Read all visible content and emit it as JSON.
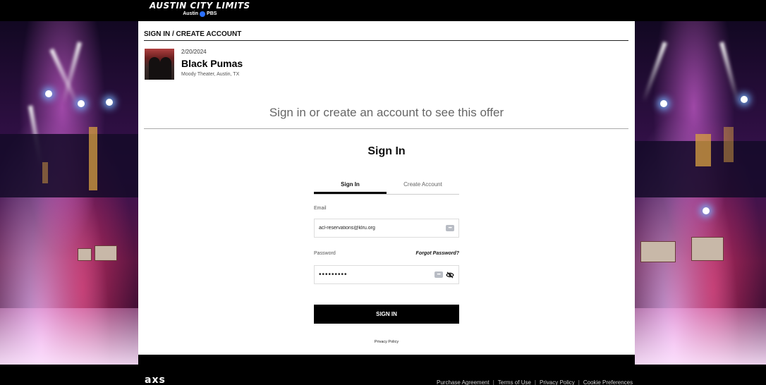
{
  "brand": {
    "logo_line1": "AUSTIN CITY LIMITS",
    "logo_line2_city": "Austin",
    "logo_line2_network": "PBS"
  },
  "panel": {
    "header": "SIGN IN / CREATE ACCOUNT"
  },
  "event": {
    "date": "2/20/2024",
    "name": "Black Pumas",
    "venue": "Moody Theater, Austin, TX"
  },
  "offer_title": "Sign in or create an account to see this offer",
  "signin": {
    "heading": "Sign In",
    "tabs": [
      {
        "label": "Sign In",
        "active": true
      },
      {
        "label": "Create Account",
        "active": false
      }
    ],
    "email_label": "Email",
    "email_value": "acl-reservations@klru.org",
    "password_label": "Password",
    "forgot_label": "Forgot Password?",
    "password_value": "•••••••••",
    "submit_label": "SIGN IN",
    "privacy_label": "Privacy Policy"
  },
  "footer": {
    "logo": "axs",
    "links": [
      "Purchase Agreement",
      "Terms of Use",
      "Privacy Policy",
      "Cookie Preferences"
    ]
  },
  "icons": {
    "keyboard": "password-manager-icon",
    "eye": "eye-slash-icon"
  }
}
